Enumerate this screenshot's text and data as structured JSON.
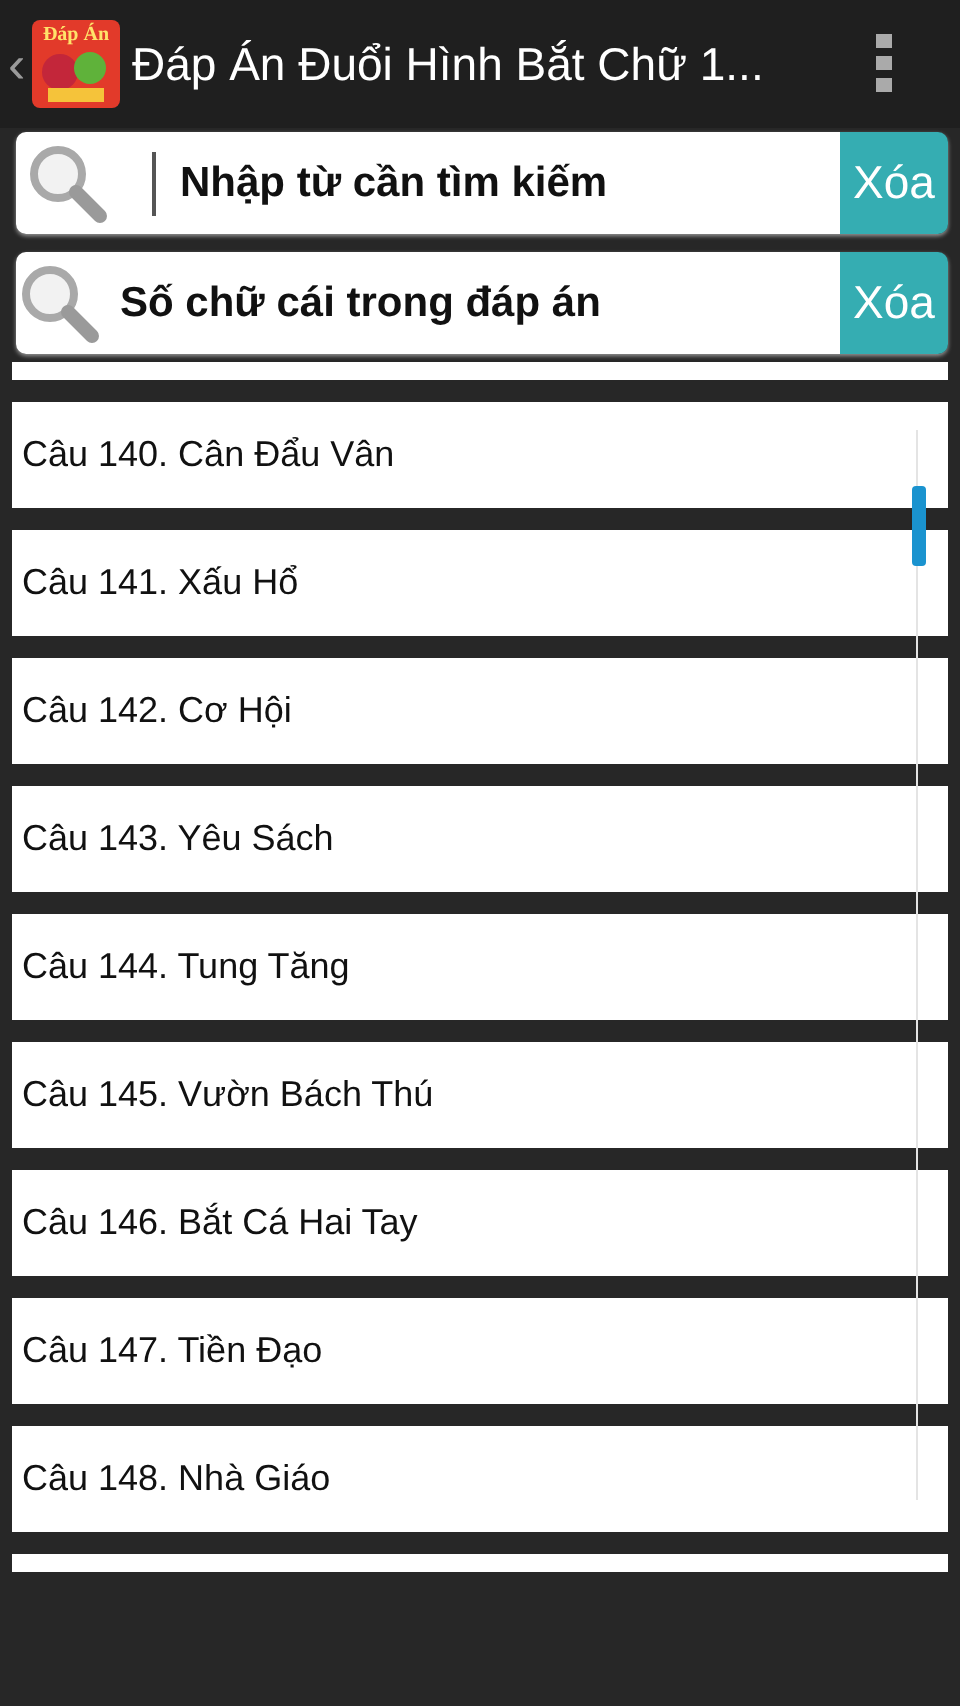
{
  "action_bar": {
    "back_glyph": "‹",
    "logo_text": "Đáp Án",
    "title": "Đáp Án Đuổi Hình Bắt Chữ 1..."
  },
  "search_fields": [
    {
      "placeholder": "Nhập từ cần tìm kiếm",
      "focused": true,
      "clear_label": "Xóa"
    },
    {
      "placeholder": "Số chữ cái trong đáp án",
      "focused": false,
      "clear_label": "Xóa"
    }
  ],
  "answers": [
    "Câu 140. Cân Đẩu Vân",
    "Câu 141. Xấu Hổ",
    "Câu 142. Cơ Hội",
    "Câu 143. Yêu Sách",
    "Câu 144. Tung Tăng",
    "Câu 145. Vườn Bách Thú",
    "Câu 146. Bắt Cá Hai Tay",
    "Câu 147. Tiền Đạo",
    "Câu 148. Nhà Giáo"
  ]
}
